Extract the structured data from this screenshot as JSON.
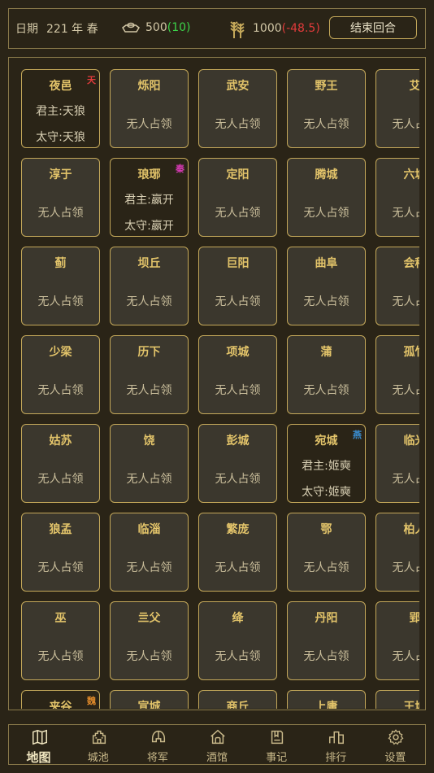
{
  "topbar": {
    "date_label": "日期",
    "date_value": "221 年 春",
    "gold_value": "500",
    "gold_delta": "(10)",
    "grain_value": "1000",
    "grain_delta": "(-48.5)",
    "end_turn_label": "结束回合"
  },
  "map": {
    "rows": [
      [
        {
          "name": "夜邑",
          "owned": true,
          "faction": "天",
          "faction_color": "#e23b3b",
          "lord": "君主:天狼",
          "gov": "太守:天狼"
        },
        {
          "name": "烁阳",
          "empty": "无人占领"
        },
        {
          "name": "武安",
          "empty": "无人占领"
        },
        {
          "name": "野王",
          "empty": "无人占领"
        },
        {
          "name": "艾",
          "empty": "无人占领"
        }
      ],
      [
        {
          "name": "淳于",
          "empty": "无人占领"
        },
        {
          "name": "琅琊",
          "owned": true,
          "faction": "秦",
          "faction_color": "#d43ab2",
          "lord": "君主:嬴开",
          "gov": "太守:嬴开"
        },
        {
          "name": "定阳",
          "empty": "无人占领"
        },
        {
          "name": "腾城",
          "empty": "无人占领"
        },
        {
          "name": "六城",
          "empty": "无人占领"
        }
      ],
      [
        {
          "name": "蓟",
          "empty": "无人占领"
        },
        {
          "name": "坝丘",
          "empty": "无人占领"
        },
        {
          "name": "巨阳",
          "empty": "无人占领"
        },
        {
          "name": "曲阜",
          "empty": "无人占领"
        },
        {
          "name": "会稽",
          "empty": "无人占领"
        }
      ],
      [
        {
          "name": "少梁",
          "empty": "无人占领"
        },
        {
          "name": "历下",
          "empty": "无人占领"
        },
        {
          "name": "项城",
          "empty": "无人占领"
        },
        {
          "name": "蒲",
          "empty": "无人占领"
        },
        {
          "name": "孤竹",
          "empty": "无人占领"
        }
      ],
      [
        {
          "name": "姑苏",
          "empty": "无人占领"
        },
        {
          "name": "饶",
          "empty": "无人占领"
        },
        {
          "name": "彭城",
          "empty": "无人占领"
        },
        {
          "name": "宛城",
          "owned": true,
          "faction": "燕",
          "faction_color": "#3a8fd4",
          "lord": "君主:姬奭",
          "gov": "太守:姬奭"
        },
        {
          "name": "临光",
          "empty": "无人占领"
        }
      ],
      [
        {
          "name": "狼孟",
          "empty": "无人占领"
        },
        {
          "name": "临淄",
          "empty": "无人占领"
        },
        {
          "name": "繁庞",
          "empty": "无人占领"
        },
        {
          "name": "鄂",
          "empty": "无人占领"
        },
        {
          "name": "柏人",
          "empty": "无人占领"
        }
      ],
      [
        {
          "name": "巫",
          "empty": "无人占领"
        },
        {
          "name": "亖父",
          "empty": "无人占领"
        },
        {
          "name": "绛",
          "empty": "无人占领"
        },
        {
          "name": "丹阳",
          "empty": "无人占领"
        },
        {
          "name": "郢",
          "empty": "无人占领"
        }
      ],
      [
        {
          "name": "夹谷",
          "owned": true,
          "faction": "魏",
          "faction_color": "#e08a2a"
        },
        {
          "name": "宣城"
        },
        {
          "name": "商丘"
        },
        {
          "name": "上庸"
        },
        {
          "name": "王城"
        }
      ]
    ]
  },
  "nav": [
    {
      "label": "地图",
      "icon": "map-icon",
      "active": true
    },
    {
      "label": "城池",
      "icon": "city-icon"
    },
    {
      "label": "将军",
      "icon": "helmet-icon"
    },
    {
      "label": "酒馆",
      "icon": "tavern-icon"
    },
    {
      "label": "事记",
      "icon": "book-icon"
    },
    {
      "label": "排行",
      "icon": "ranking-icon"
    },
    {
      "label": "设置",
      "icon": "gear-icon"
    }
  ]
}
